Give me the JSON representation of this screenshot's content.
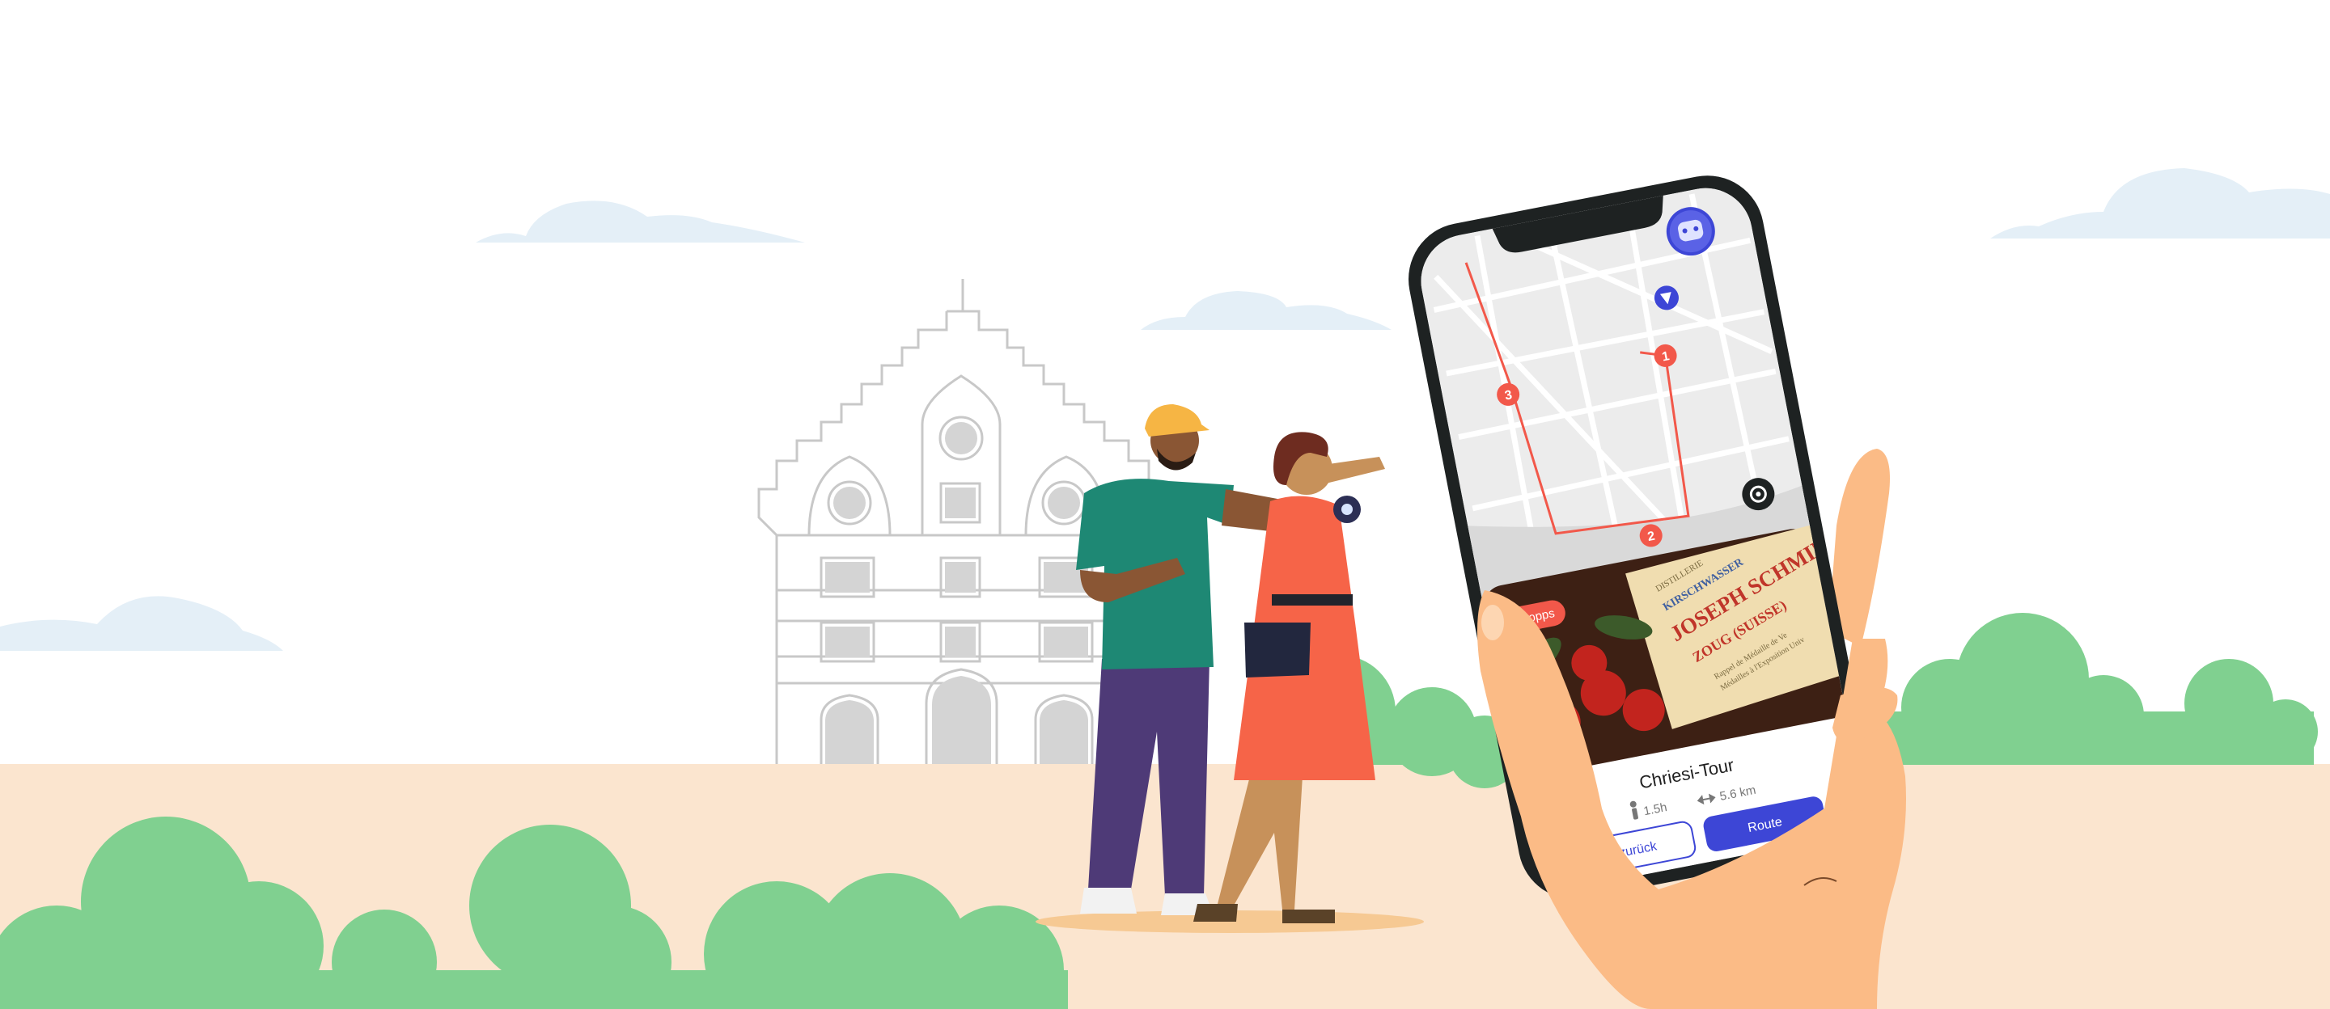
{
  "app": {
    "card": {
      "badge": "4 Stopps",
      "title": "Chriesi-Tour",
      "duration": "1.5h",
      "distance": "5.6 km",
      "back_label": "zurück",
      "route_label": "Route"
    },
    "map": {
      "stops": [
        "1",
        "2",
        "3"
      ]
    },
    "postcard": {
      "brand_line1": "JOSEPH SCHMIDT",
      "brand_line2": "ZOUG (SUISSE)",
      "product": "KIRSCHWASSER",
      "distillery": "DISTILLERIE",
      "details_line1": "Rappel de Médaille de Ve",
      "details_line2": "Médailles à l'Exposition Univ"
    }
  },
  "icons": {
    "avatar": "robot-avatar-icon",
    "location": "user-location-icon",
    "recenter": "recenter-target-icon",
    "walk": "walking-person-icon",
    "distance": "distance-arrow-icon"
  },
  "colors": {
    "sky": "#ffffff",
    "ground": "#fbe5cf",
    "bush": "#80d090",
    "cloud": "#e4eff7",
    "accent": "#3d46d6",
    "route": "#f2584a",
    "map_bg": "#ececec",
    "phone": "#1e2222"
  }
}
